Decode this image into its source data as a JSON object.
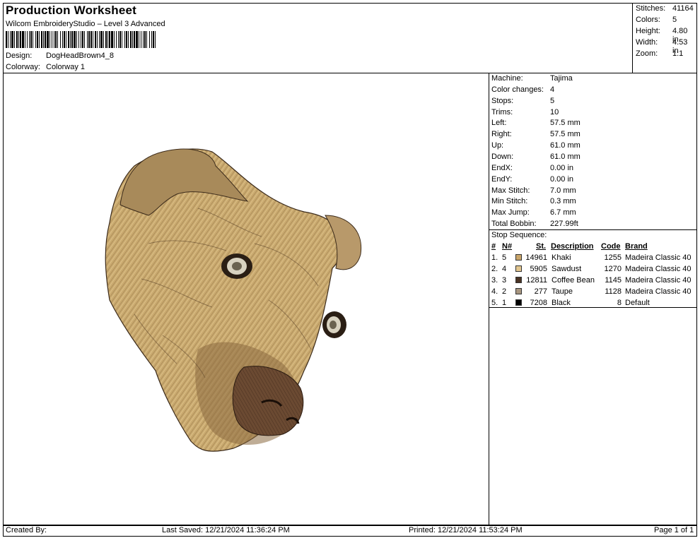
{
  "header": {
    "title": "Production Worksheet",
    "subtitle": "Wilcom EmbroideryStudio – Level 3 Advanced",
    "design_label": "Design:",
    "design_value": "DogHeadBrown4_8",
    "colorway_label": "Colorway:",
    "colorway_value": "Colorway 1"
  },
  "stats": {
    "stitches_label": "Stitches:",
    "stitches_value": "41164",
    "colors_label": "Colors:",
    "colors_value": "5",
    "height_label": "Height:",
    "height_value": "4.80 in",
    "width_label": "Width:",
    "width_value": "4.53 in",
    "zoom_label": "Zoom:",
    "zoom_value": "1:1"
  },
  "machine_info": [
    {
      "label": "Machine:",
      "value": "Tajima"
    },
    {
      "label": "Color changes:",
      "value": "4"
    },
    {
      "label": "Stops:",
      "value": "5"
    },
    {
      "label": "Trims:",
      "value": "10"
    },
    {
      "label": "Left:",
      "value": "57.5 mm"
    },
    {
      "label": "Right:",
      "value": "57.5 mm"
    },
    {
      "label": "Up:",
      "value": "61.0 mm"
    },
    {
      "label": "Down:",
      "value": "61.0 mm"
    },
    {
      "label": "EndX:",
      "value": "0.00 in"
    },
    {
      "label": "EndY:",
      "value": "0.00 in"
    },
    {
      "label": "Max Stitch:",
      "value": "7.0 mm"
    },
    {
      "label": "Min Stitch:",
      "value": "0.3 mm"
    },
    {
      "label": "Max Jump:",
      "value": "6.7 mm"
    },
    {
      "label": "Total Bobbin:",
      "value": "227.99ft"
    }
  ],
  "stop_sequence": {
    "title": "Stop Sequence:",
    "headers": {
      "num": "#",
      "n": "N#",
      "st": "St.",
      "desc": "Description",
      "code": "Code",
      "brand": "Brand"
    },
    "rows": [
      {
        "num": "1.",
        "n": "5",
        "color": "#c9a56a",
        "st": "14961",
        "desc": "Khaki",
        "code": "1255",
        "brand": "Madeira Classic 40"
      },
      {
        "num": "2.",
        "n": "4",
        "color": "#e2c690",
        "st": "5905",
        "desc": "Sawdust",
        "code": "1270",
        "brand": "Madeira Classic 40"
      },
      {
        "num": "3.",
        "n": "3",
        "color": "#4a3424",
        "st": "12811",
        "desc": "Coffee Bean",
        "code": "1145",
        "brand": "Madeira Classic 40"
      },
      {
        "num": "4.",
        "n": "2",
        "color": "#a89680",
        "st": "277",
        "desc": "Taupe",
        "code": "1128",
        "brand": "Madeira Classic 40"
      },
      {
        "num": "5.",
        "n": "1",
        "color": "#000000",
        "st": "7208",
        "desc": "Black",
        "code": "8",
        "brand": "Default"
      }
    ]
  },
  "footer": {
    "created_by": "Created By:",
    "last_saved": "Last Saved: 12/21/2024 11:36:24 PM",
    "printed": "Printed: 12/21/2024 11:53:24 PM",
    "page": "Page 1 of 1"
  }
}
